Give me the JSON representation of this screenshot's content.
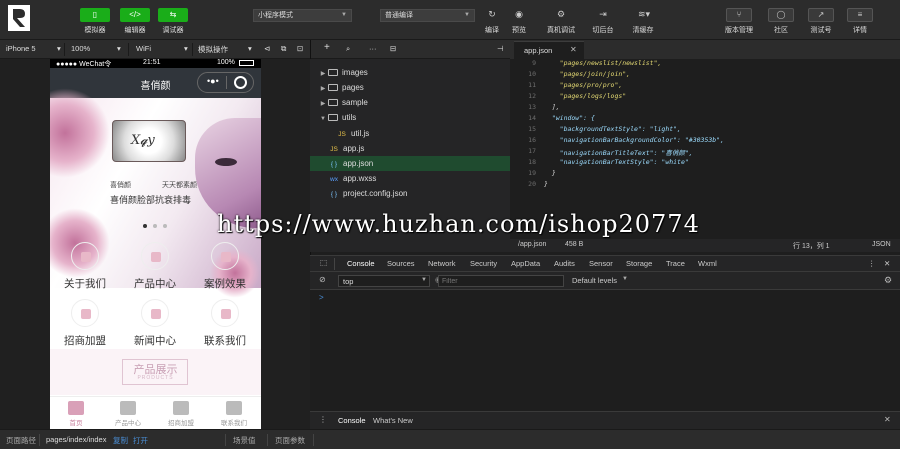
{
  "toolbar": {
    "buttons": [
      {
        "label": "模拟器",
        "icon": "phone-icon"
      },
      {
        "label": "编辑器",
        "icon": "code-icon"
      },
      {
        "label": "调试器",
        "icon": "debug-icon"
      }
    ],
    "mode_select": "小程序模式",
    "compile_select": "普通编译",
    "tools": [
      "编译",
      "预览",
      "真机调试",
      "切后台",
      "清缓存"
    ],
    "right": [
      "版本管理",
      "社区",
      "测试号",
      "详情"
    ]
  },
  "bar2": {
    "device": "iPhone 5",
    "zoom": "100%",
    "network": "WiFi",
    "sim_op": "模拟操作"
  },
  "phone": {
    "status_left": "●●●●● WeChat令",
    "status_time": "21:51",
    "status_right": "100%",
    "nav_title": "喜俏颜",
    "banner_brand_left": "喜俏颜",
    "banner_brand_right": "天天都素颜",
    "banner_slogan": "喜俏颜脸部抗衰排毒",
    "menu": [
      "关于我们",
      "产品中心",
      "案例效果",
      "招商加盟",
      "新闻中心",
      "联系我们"
    ],
    "showcase_title": "产品展示",
    "showcase_sub": "PRODUCTS",
    "tabs": [
      "首页",
      "产品中心",
      "招商加盟",
      "联系我们"
    ]
  },
  "tree": [
    {
      "name": "images",
      "type": "folder",
      "open": false,
      "depth": 0
    },
    {
      "name": "pages",
      "type": "folder",
      "open": false,
      "depth": 0
    },
    {
      "name": "sample",
      "type": "folder",
      "open": false,
      "depth": 0
    },
    {
      "name": "utils",
      "type": "folder",
      "open": true,
      "depth": 0
    },
    {
      "name": "util.js",
      "type": "js",
      "depth": 1
    },
    {
      "name": "app.js",
      "type": "js",
      "depth": 0
    },
    {
      "name": "app.json",
      "type": "json",
      "depth": 0,
      "selected": true
    },
    {
      "name": "app.wxss",
      "type": "wxss",
      "depth": 0
    },
    {
      "name": "project.config.json",
      "type": "json",
      "depth": 0
    }
  ],
  "editor": {
    "tab": "app.json",
    "lines": [
      {
        "n": "9",
        "text": "    \"pages/newslist/newslist\","
      },
      {
        "n": "10",
        "text": "    \"pages/join/join\","
      },
      {
        "n": "11",
        "text": "    \"pages/pro/pro\","
      },
      {
        "n": "12",
        "text": "    \"pages/logs/logs\""
      },
      {
        "n": "13",
        "text": "  ],"
      },
      {
        "n": "14",
        "text": "  \"window\": {"
      },
      {
        "n": "15",
        "text": "    \"backgroundTextStyle\": \"light\","
      },
      {
        "n": "16",
        "text": "    \"navigationBarBackgroundColor\": \"#30353b\","
      },
      {
        "n": "17",
        "text": "    \"navigationBarTitleText\": \"喜俏颜\","
      },
      {
        "n": "18",
        "text": "    \"navigationBarTextStyle\": \"white\""
      },
      {
        "n": "19",
        "text": "  }"
      },
      {
        "n": "20",
        "text": "}"
      }
    ],
    "status_file": "/app.json",
    "status_size": "458 B",
    "status_pos": "行 13，列 1",
    "status_lang": "JSON"
  },
  "devtools": {
    "tabs": [
      "Console",
      "Sources",
      "Network",
      "Security",
      "AppData",
      "Audits",
      "Sensor",
      "Storage",
      "Trace",
      "Wxml"
    ],
    "context": "top",
    "filter_placeholder": "Filter",
    "levels": "Default levels",
    "prompt": ">",
    "drawer_tabs": [
      "Console",
      "What's New"
    ]
  },
  "bottom": {
    "path_label": "页面路径",
    "path": "pages/index/index",
    "copy": "复制",
    "open": "打开",
    "scene": "场景值",
    "params": "页面参数"
  },
  "watermark": "https://www.huzhan.com/ishop20774",
  "colors": {
    "accent": "#1aad19",
    "nav": "#30353b",
    "selected_row": "#1f4b2f"
  }
}
